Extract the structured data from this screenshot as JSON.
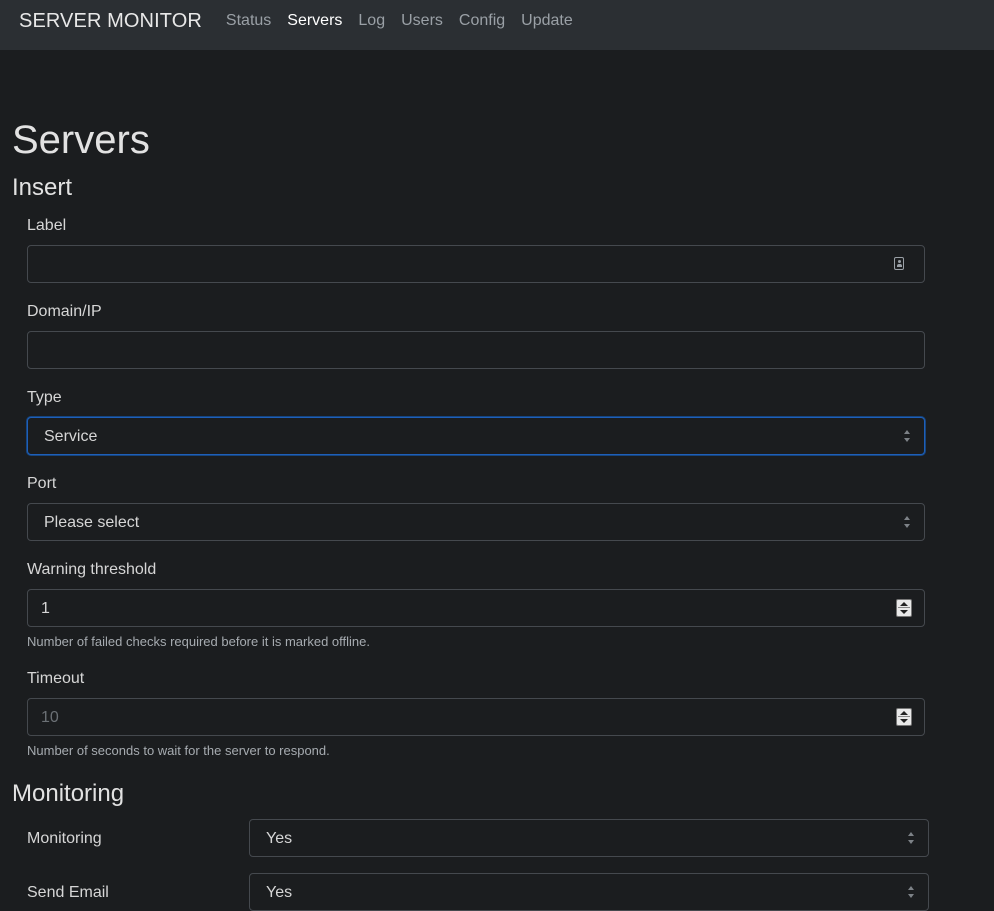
{
  "navbar": {
    "brand": "SERVER MONITOR",
    "links": [
      "Status",
      "Servers",
      "Log",
      "Users",
      "Config",
      "Update"
    ],
    "active": "Servers"
  },
  "page": {
    "title": "Servers"
  },
  "insert": {
    "section_title": "Insert",
    "label_field": {
      "label": "Label",
      "value": "",
      "icon": "contact-card-icon"
    },
    "domain_field": {
      "label": "Domain/IP",
      "value": ""
    },
    "type_field": {
      "label": "Type",
      "selected": "Service"
    },
    "port_field": {
      "label": "Port",
      "selected": "Please select"
    },
    "warning_field": {
      "label": "Warning threshold",
      "value": "1",
      "help": "Number of failed checks required before it is marked offline."
    },
    "timeout_field": {
      "label": "Timeout",
      "placeholder": "10",
      "help": "Number of seconds to wait for the server to respond."
    }
  },
  "monitoring": {
    "section_title": "Monitoring",
    "rows": [
      {
        "label": "Monitoring",
        "selected": "Yes"
      },
      {
        "label": "Send Email",
        "selected": "Yes"
      }
    ]
  },
  "colors": {
    "background": "#1b1d1f",
    "navbar": "#2b2f33",
    "focus_border": "#1f5fb8"
  }
}
